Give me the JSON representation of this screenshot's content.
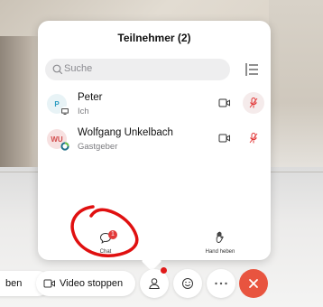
{
  "panel": {
    "title": "Teilnehmer (2)",
    "search_placeholder": "Suche"
  },
  "participants": [
    {
      "initials": "P",
      "name": "Peter",
      "role": "Ich",
      "muted": true
    },
    {
      "initials": "WU",
      "name": "Wolfgang Unkelbach",
      "role": "Gastgeber",
      "muted": true
    }
  ],
  "panel_actions": {
    "chat_label": "Chat",
    "chat_badge": "1",
    "raise_hand_label": "Hand heben"
  },
  "toolbar": {
    "left_partial_label": "ben",
    "video_stop_label": "Video stoppen"
  },
  "colors": {
    "accent_red": "#e8543f",
    "mute_red": "#e23a3a",
    "annotation_red": "#e01010"
  }
}
